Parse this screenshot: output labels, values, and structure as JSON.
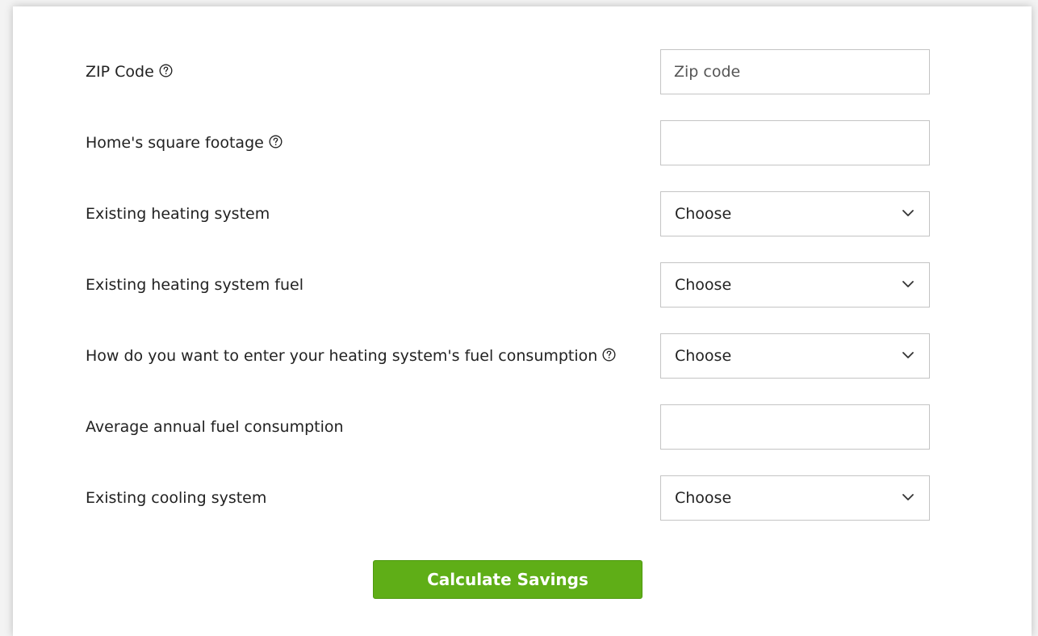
{
  "form": {
    "zip": {
      "label": "ZIP Code",
      "placeholder": "Zip code",
      "value": ""
    },
    "sqft": {
      "label": "Home's square footage",
      "value": ""
    },
    "heating_system": {
      "label": "Existing heating system",
      "selected": "Choose"
    },
    "heating_fuel": {
      "label": "Existing heating system fuel",
      "selected": "Choose"
    },
    "consumption_entry": {
      "label": "How do you want to enter your heating system's fuel consumption",
      "selected": "Choose"
    },
    "annual_consumption": {
      "label": "Average annual fuel consumption",
      "value": ""
    },
    "cooling_system": {
      "label": "Existing cooling system",
      "selected": "Choose"
    }
  },
  "actions": {
    "calculate_label": "Calculate Savings"
  },
  "icons": {
    "help": "question-circle-icon",
    "dropdown": "chevron-down-icon"
  },
  "colors": {
    "button_bg": "#5fae17",
    "button_text": "#ffffff"
  }
}
